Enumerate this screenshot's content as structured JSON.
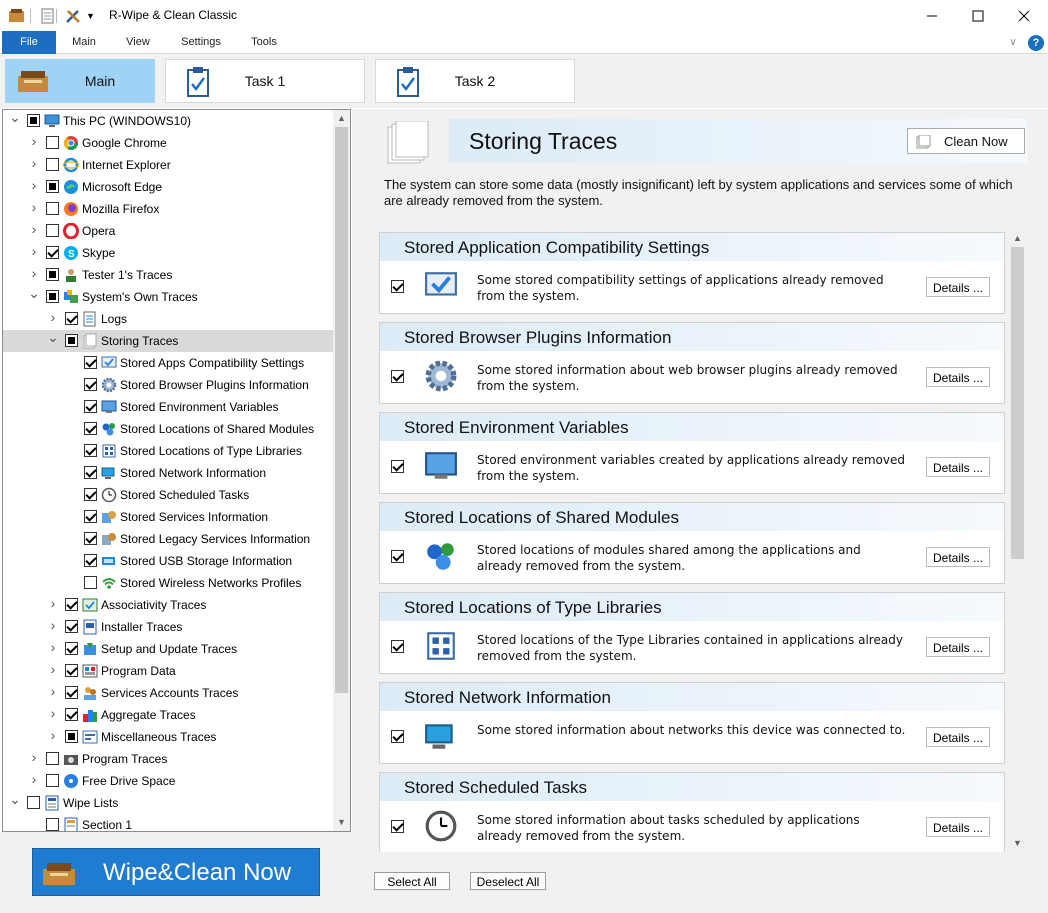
{
  "window": {
    "title": "R-Wipe & Clean Classic",
    "controls": [
      "minimize-icon",
      "maximize-icon",
      "close-icon"
    ]
  },
  "menu": {
    "items": [
      "File",
      "Main",
      "View",
      "Settings",
      "Tools"
    ],
    "help_icon": "?"
  },
  "tabs": [
    {
      "label": "Main",
      "active": true
    },
    {
      "label": "Task 1",
      "active": false
    },
    {
      "label": "Task 2",
      "active": false
    }
  ],
  "tree": [
    {
      "label": "This PC  (WINDOWS10)",
      "level": 0,
      "expanded": true,
      "state": "partial",
      "icon": "computer-icon"
    },
    {
      "label": "Google Chrome",
      "level": 1,
      "expanded": false,
      "state": "none",
      "icon": "chrome-icon"
    },
    {
      "label": "Internet  Explorer",
      "level": 1,
      "expanded": false,
      "state": "none",
      "icon": "ie-icon"
    },
    {
      "label": "Microsoft Edge",
      "level": 1,
      "expanded": false,
      "state": "partial",
      "icon": "edge-icon"
    },
    {
      "label": "Mozilla Firefox",
      "level": 1,
      "expanded": false,
      "state": "none",
      "icon": "firefox-icon"
    },
    {
      "label": "Opera",
      "level": 1,
      "expanded": false,
      "state": "none",
      "icon": "opera-icon"
    },
    {
      "label": "Skype",
      "level": 1,
      "expanded": false,
      "state": "checked",
      "icon": "skype-icon"
    },
    {
      "label": "Tester 1's Traces",
      "level": 1,
      "expanded": false,
      "state": "partial",
      "icon": "user-icon"
    },
    {
      "label": "System's Own Traces",
      "level": 1,
      "expanded": true,
      "state": "partial",
      "icon": "system-icon"
    },
    {
      "label": "Logs",
      "level": 2,
      "expanded": false,
      "state": "checked",
      "icon": "log-icon"
    },
    {
      "label": "Storing Traces",
      "level": 2,
      "expanded": true,
      "state": "partial",
      "icon": "document-icon",
      "selected": true
    },
    {
      "label": "Stored Apps Compatibility Settings",
      "level": 3,
      "state": "checked",
      "icon": "compatibility-icon"
    },
    {
      "label": "Stored Browser Plugins Information",
      "level": 3,
      "state": "checked",
      "icon": "gear-icon"
    },
    {
      "label": "Stored Environment Variables",
      "level": 3,
      "state": "checked",
      "icon": "monitor-icon"
    },
    {
      "label": "Stored Locations of Shared Modules",
      "level": 3,
      "state": "checked",
      "icon": "modules-icon"
    },
    {
      "label": "Stored Locations of Type Libraries",
      "level": 3,
      "state": "checked",
      "icon": "library-icon"
    },
    {
      "label": "Stored Network Information",
      "level": 3,
      "state": "checked",
      "icon": "network-icon"
    },
    {
      "label": "Stored Scheduled Tasks",
      "level": 3,
      "state": "checked",
      "icon": "clock-icon"
    },
    {
      "label": "Stored Services Information",
      "level": 3,
      "state": "checked",
      "icon": "services-icon"
    },
    {
      "label": "Stored Legacy Services Information",
      "level": 3,
      "state": "checked",
      "icon": "legacy-services-icon"
    },
    {
      "label": "Stored USB Storage Information",
      "level": 3,
      "state": "checked",
      "icon": "usb-icon"
    },
    {
      "label": "Stored Wireless Networks Profiles",
      "level": 3,
      "state": "none",
      "icon": "wifi-icon"
    },
    {
      "label": "Associativity Traces",
      "level": 2,
      "expanded": false,
      "state": "checked",
      "icon": "associativity-icon"
    },
    {
      "label": "Installer Traces",
      "level": 2,
      "expanded": false,
      "state": "checked",
      "icon": "installer-icon"
    },
    {
      "label": "Setup and Update Traces",
      "level": 2,
      "expanded": false,
      "state": "checked",
      "icon": "setup-icon"
    },
    {
      "label": "Program Data",
      "level": 2,
      "expanded": false,
      "state": "checked",
      "icon": "program-data-icon"
    },
    {
      "label": "Services Accounts Traces",
      "level": 2,
      "expanded": false,
      "state": "checked",
      "icon": "accounts-icon"
    },
    {
      "label": "Aggregate Traces",
      "level": 2,
      "expanded": false,
      "state": "checked",
      "icon": "aggregate-icon"
    },
    {
      "label": "Miscellaneous Traces",
      "level": 2,
      "expanded": false,
      "state": "partial",
      "icon": "misc-icon"
    },
    {
      "label": "Program Traces",
      "level": 1,
      "expanded": false,
      "state": "none",
      "icon": "camera-icon"
    },
    {
      "label": "Free Drive Space",
      "level": 1,
      "expanded": false,
      "state": "none",
      "icon": "disk-icon"
    },
    {
      "label": "Wipe Lists",
      "level": 0,
      "expanded": true,
      "state": "none",
      "icon": "wipe-list-icon"
    },
    {
      "label": "Section 1",
      "level": 1,
      "state": "none",
      "icon": "section-icon"
    }
  ],
  "wipe_button": "Wipe&Clean Now",
  "panel": {
    "title": "Storing Traces",
    "clean_now": "Clean Now",
    "description": "The system can store some data (mostly insignificant) left by system applications and services some of which are already removed from the system.",
    "cards": [
      {
        "title": "Stored Application Compatibility Settings",
        "text": "Some stored compatibility settings of applications already removed from the system.",
        "details": "Details ...",
        "checked": true,
        "icon": "compatibility-icon"
      },
      {
        "title": "Stored Browser Plugins Information",
        "text": "Some stored information about web browser plugins already removed from the system.",
        "details": "Details ...",
        "checked": true,
        "icon": "gear-icon"
      },
      {
        "title": "Stored Environment Variables",
        "text": "Stored environment variables created by applications already removed from the system.",
        "details": "Details ...",
        "checked": true,
        "icon": "monitor-icon"
      },
      {
        "title": "Stored Locations of Shared Modules",
        "text": "Stored locations of modules shared among the applications and already removed from the system.",
        "details": "Details ...",
        "checked": true,
        "icon": "modules-icon"
      },
      {
        "title": "Stored Locations of Type Libraries",
        "text": "Stored locations of the Type Libraries contained in applications already removed from the system.",
        "details": "Details ...",
        "checked": true,
        "icon": "library-icon"
      },
      {
        "title": "Stored Network Information",
        "text": "Some stored information about networks this device was connected to.",
        "details": "Details ...",
        "checked": true,
        "icon": "network-icon"
      },
      {
        "title": "Stored Scheduled Tasks",
        "text": "Some stored information about tasks scheduled by applications already removed from the system.",
        "details": "Details ...",
        "checked": true,
        "icon": "clock-icon"
      }
    ],
    "select_all": "Select All",
    "deselect_all": "Deselect All"
  },
  "colors": {
    "accent": "#1b6ec2",
    "active_tab": "#9fd3f5",
    "header_band": "#dcebf6",
    "wipe_button": "#1f7cd1"
  }
}
